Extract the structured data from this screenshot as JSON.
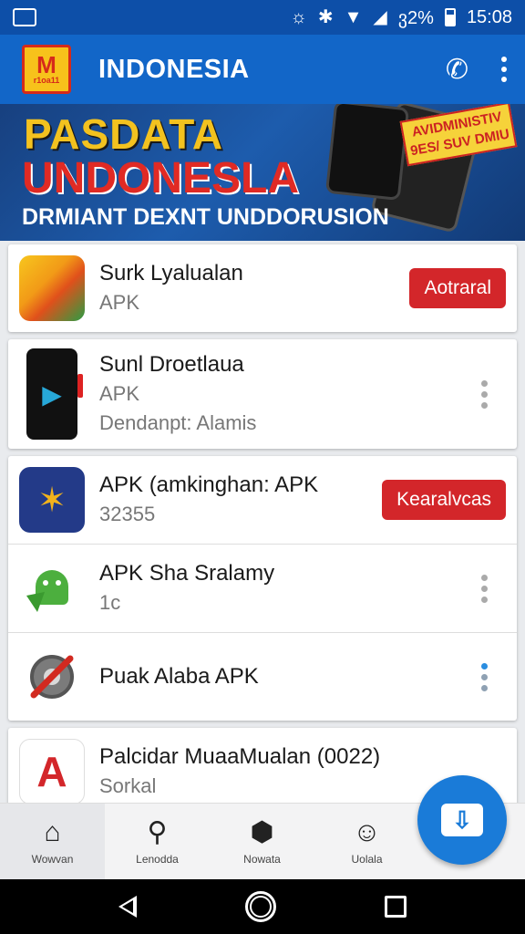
{
  "status_bar": {
    "battery": "ვ2%",
    "time": "15:08"
  },
  "app_bar": {
    "title": "INDONESIA",
    "logo_text": "r1oa11"
  },
  "banner": {
    "line1": "PASDATA",
    "line2": "UNDONESLA",
    "line3": "DRMIANT DEXNT UNDDORUSION",
    "sticker": "AVIDMINISTIV 9ES/ SUV DMIU"
  },
  "apps": [
    {
      "name": "Surk Lyalualan",
      "sub": "APK",
      "button": "Aotraral"
    },
    {
      "name": "Sunl Droetlaua",
      "sub": "APK",
      "detail": "Dendanpt: Alamis"
    },
    {
      "name": "APK (amkinghan: APK",
      "sub": "32355",
      "button": "Kearalvcas"
    },
    {
      "name": "APK Sha Sralamy",
      "sub": "1c"
    },
    {
      "name": "Puak Alaba APK"
    },
    {
      "name": "Palcidar MuaaMualan (0022)",
      "sub": "Sorkal"
    }
  ],
  "bottom_nav": [
    {
      "label": "Wowvan",
      "icon": "home-icon"
    },
    {
      "label": "Lenodda",
      "icon": "search-icon"
    },
    {
      "label": "Nowata",
      "icon": "badge-icon"
    },
    {
      "label": "Uolala",
      "icon": "profile-icon"
    }
  ],
  "colors": {
    "primary": "#1266c8",
    "status": "#0d4fa8",
    "accent_red": "#d3262a",
    "fab": "#1a7bd8"
  }
}
